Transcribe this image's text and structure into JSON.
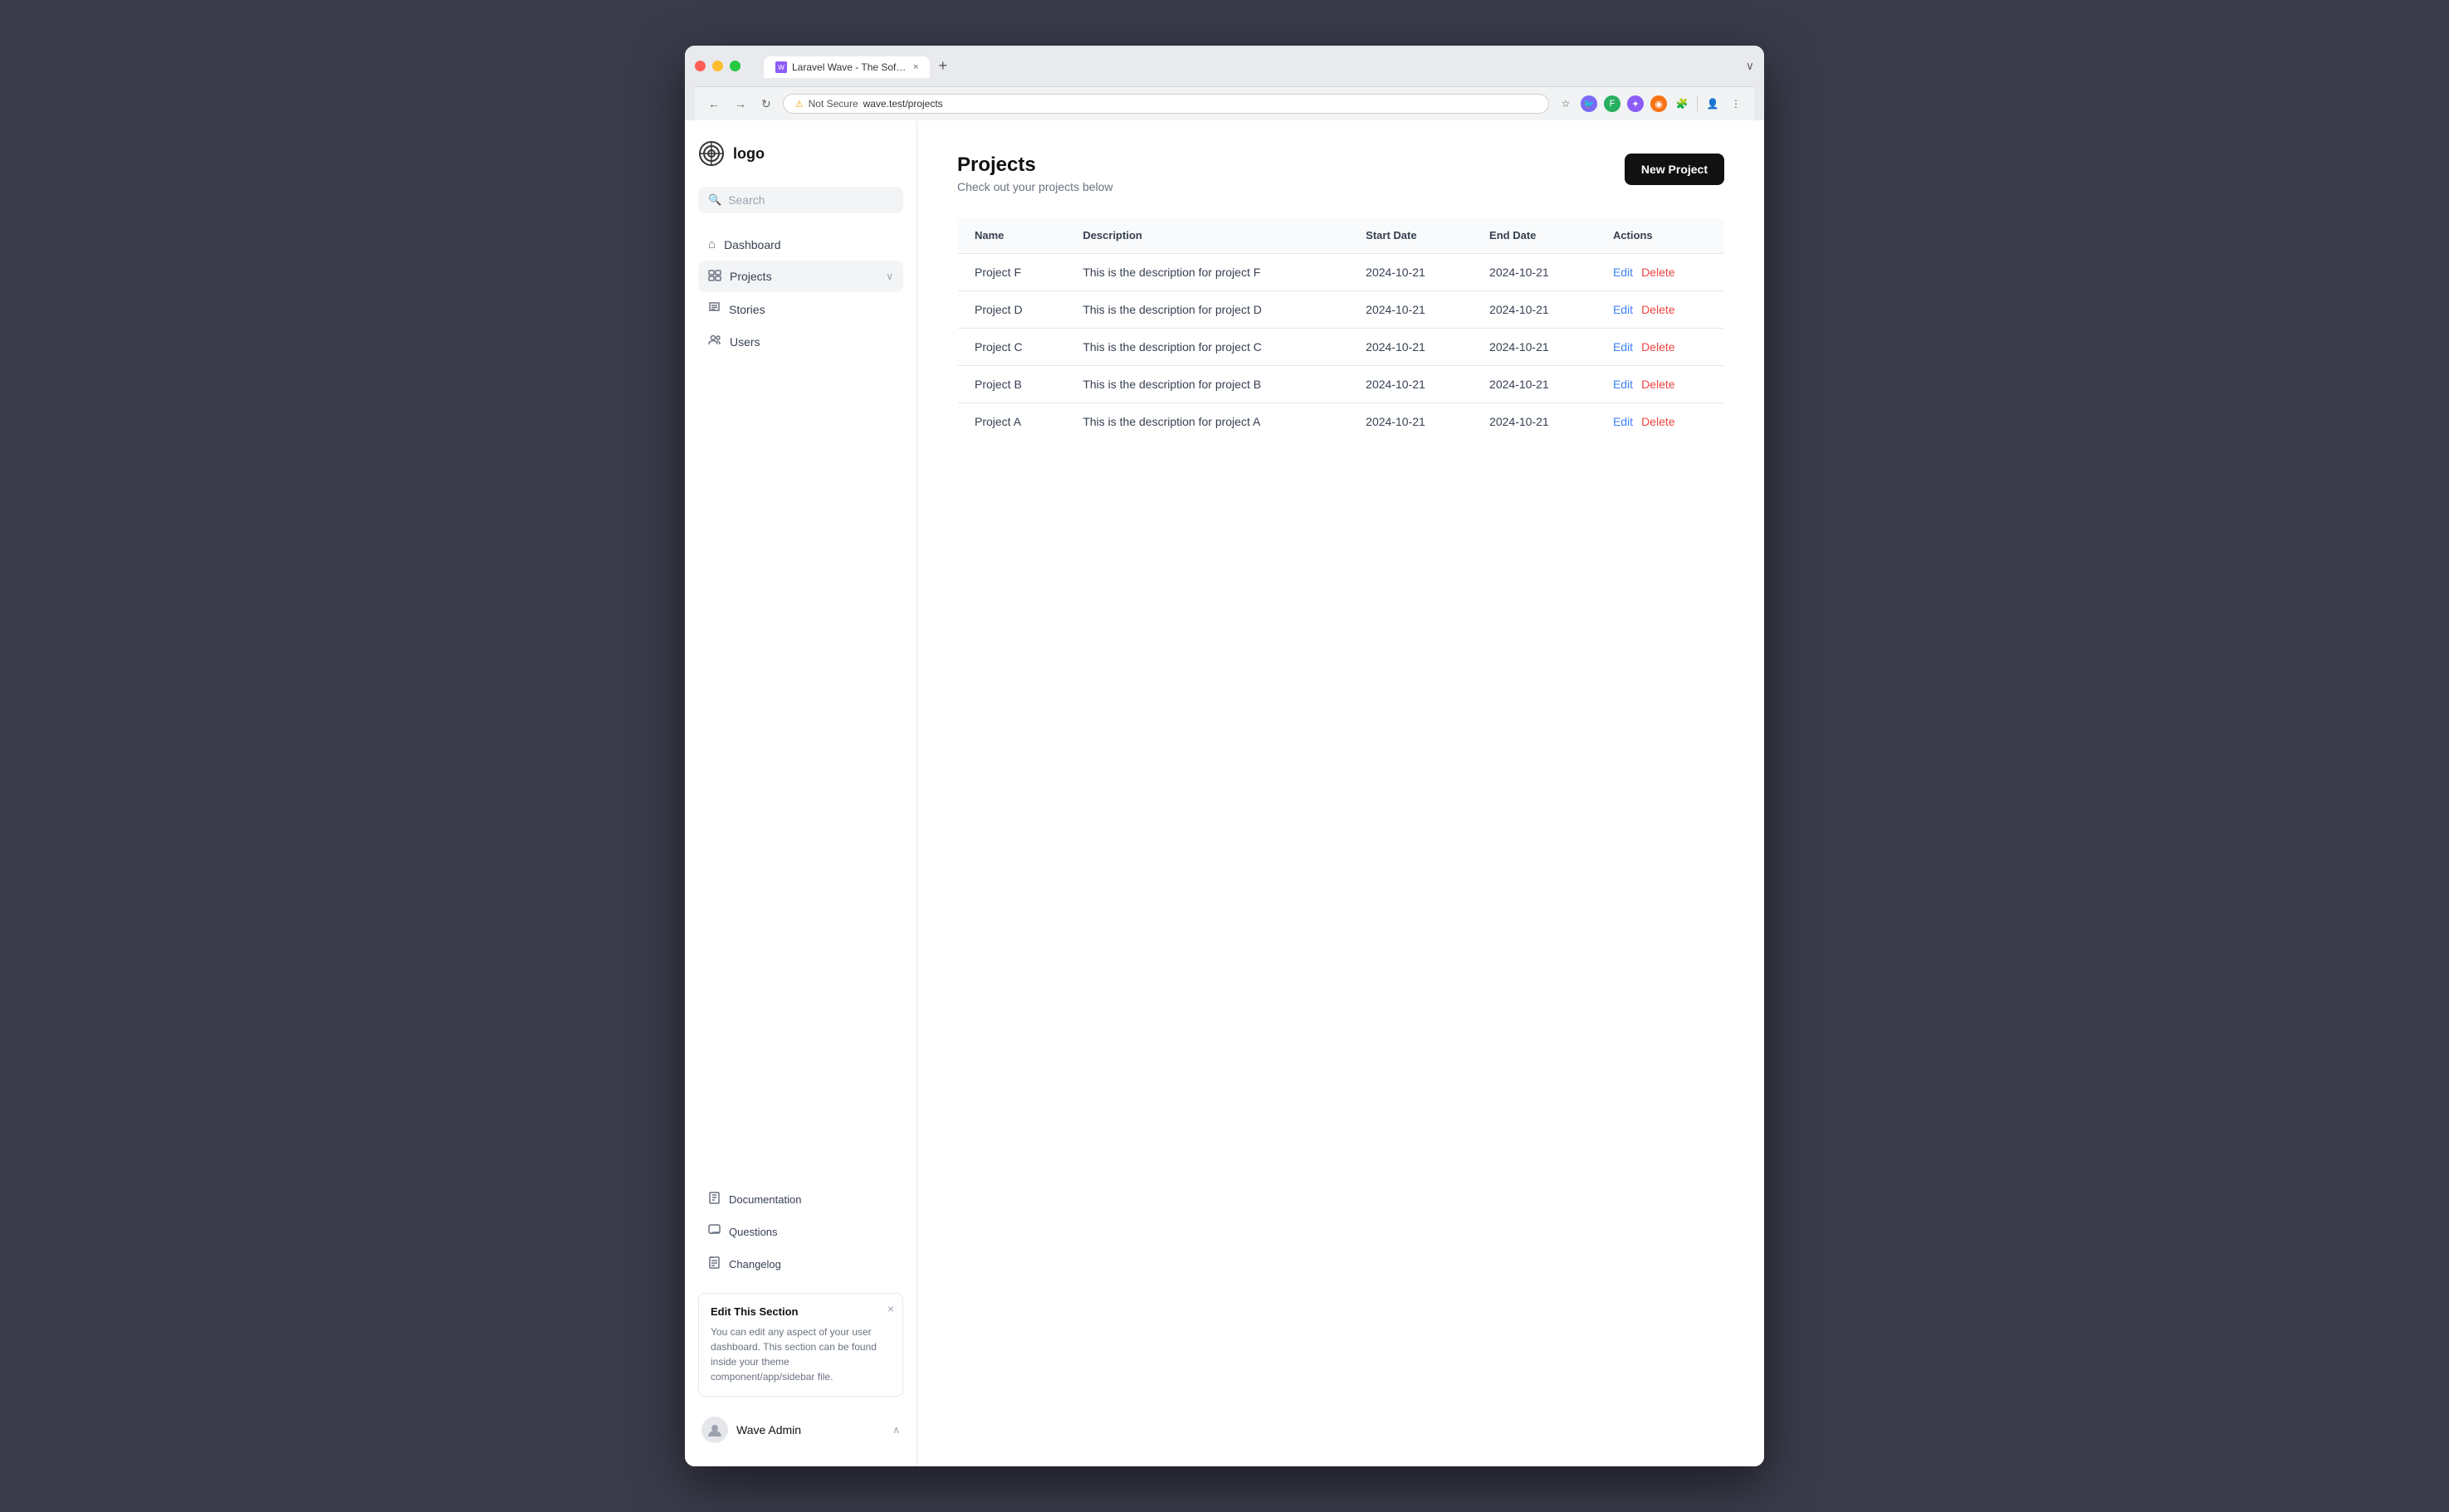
{
  "browser": {
    "tab_title": "Laravel Wave - The Software",
    "tab_favicon": "favicon",
    "url_warning": "Not Secure",
    "url": "wave.test/projects",
    "nav_back": "←",
    "nav_forward": "→",
    "nav_refresh": "↻",
    "new_tab": "+",
    "more_options": "⋮",
    "expand_icon": "∨"
  },
  "sidebar": {
    "logo_text": "logo",
    "search_placeholder": "Search",
    "nav_items": [
      {
        "id": "dashboard",
        "label": "Dashboard",
        "icon": "⌂"
      },
      {
        "id": "projects",
        "label": "Projects",
        "icon": "◈",
        "active": true,
        "has_chevron": true
      },
      {
        "id": "stories",
        "label": "Stories",
        "icon": "✏"
      },
      {
        "id": "users",
        "label": "Users",
        "icon": "👥"
      }
    ],
    "bottom_nav": [
      {
        "id": "documentation",
        "label": "Documentation",
        "icon": "📋"
      },
      {
        "id": "questions",
        "label": "Questions",
        "icon": "💬"
      },
      {
        "id": "changelog",
        "label": "Changelog",
        "icon": "📖"
      }
    ],
    "edit_section": {
      "title": "Edit This Section",
      "text": "You can edit any aspect of your user dashboard. This section can be found inside your theme component/app/sidebar file."
    },
    "user": {
      "name": "Wave Admin",
      "chevron": "∧"
    }
  },
  "main": {
    "page_title": "Projects",
    "page_subtitle": "Check out your projects below",
    "new_project_button": "New Project",
    "table": {
      "columns": [
        "Name",
        "Description",
        "Start Date",
        "End Date",
        "Actions"
      ],
      "rows": [
        {
          "name": "Project F",
          "description": "This is the description for project F",
          "start_date": "2024-10-21",
          "end_date": "2024-10-21"
        },
        {
          "name": "Project D",
          "description": "This is the description for project D",
          "start_date": "2024-10-21",
          "end_date": "2024-10-21"
        },
        {
          "name": "Project C",
          "description": "This is the description for project C",
          "start_date": "2024-10-21",
          "end_date": "2024-10-21"
        },
        {
          "name": "Project B",
          "description": "This is the description for project B",
          "start_date": "2024-10-21",
          "end_date": "2024-10-21"
        },
        {
          "name": "Project A",
          "description": "This is the description for project A",
          "start_date": "2024-10-21",
          "end_date": "2024-10-21"
        }
      ],
      "action_edit": "Edit",
      "action_delete": "Delete"
    }
  },
  "colors": {
    "edit": "#3b82f6",
    "delete": "#ef4444",
    "new_project_bg": "#111111"
  }
}
